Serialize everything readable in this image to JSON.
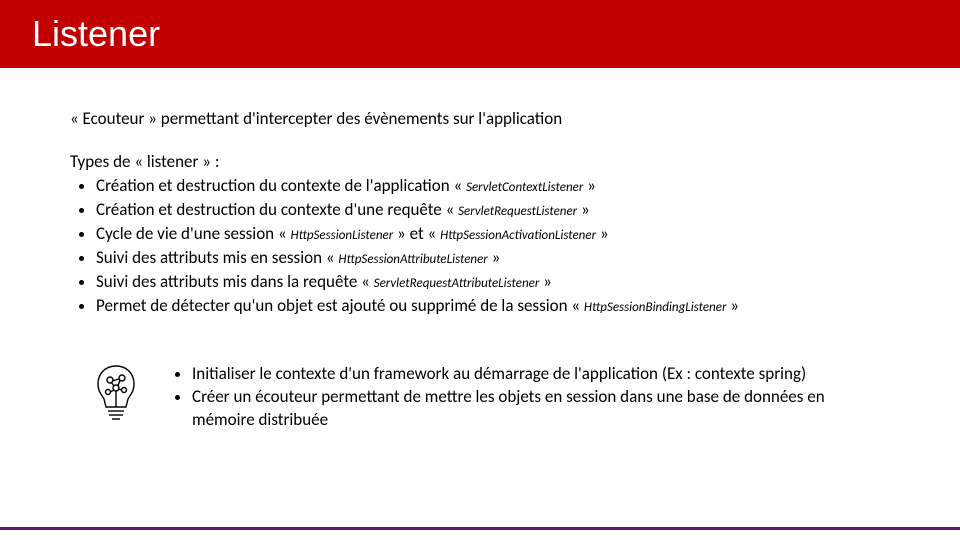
{
  "title": "Listener",
  "intro": "« Ecouteur » permettant d'intercepter des évènements sur l'application",
  "types_heading": "Types de « listener »  :",
  "items": [
    {
      "prefix": "Création et destruction du contexte de l'application « ",
      "code": "ServletContextListener",
      "suffix": " »"
    },
    {
      "prefix": "Création et destruction du contexte d'une requête « ",
      "code": "ServletRequestListener",
      "suffix": " »"
    },
    {
      "prefix": "Cycle de vie d'une session « ",
      "code": "HttpSessionListener",
      "mid": " » et « ",
      "code2": "HttpSessionActivationListener",
      "suffix": " »"
    },
    {
      "prefix": "Suivi des attributs mis en session « ",
      "code": "HttpSessionAttributeListener",
      "suffix": " »"
    },
    {
      "prefix": "Suivi des attributs mis dans la requête « ",
      "code": "ServletRequestAttributeListener",
      "suffix": " »"
    },
    {
      "prefix": "Permet de détecter qu'un objet est ajouté ou supprimé de la session « ",
      "code": "HttpSessionBindingListener",
      "suffix": " »"
    }
  ],
  "ideas": [
    "Initialiser le contexte d'un framework au démarrage de l'application (Ex : contexte spring)",
    "Créer un écouteur permettant de mettre les objets en session dans une base de données en mémoire distribuée"
  ]
}
